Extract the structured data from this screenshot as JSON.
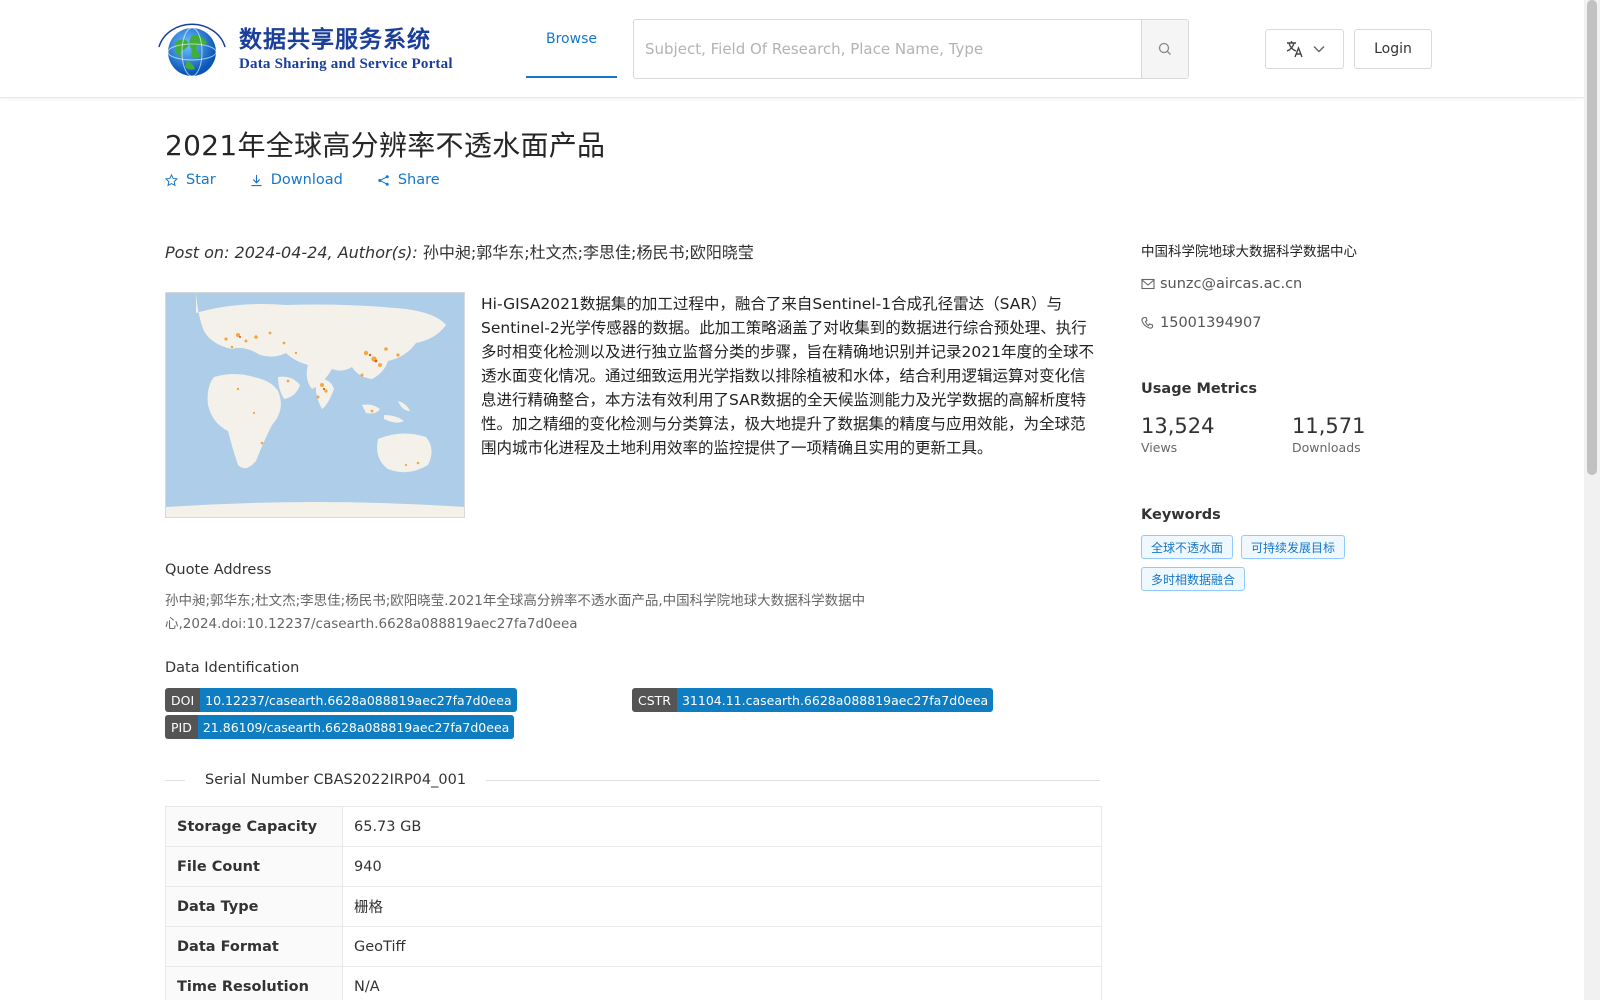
{
  "header": {
    "logo_cn": "数据共享服务系统",
    "logo_en": "Data Sharing and Service Portal",
    "nav_browse": "Browse",
    "search_placeholder": "Subject, Field Of Research, Place Name, Type",
    "login": "Login"
  },
  "dataset": {
    "title": "2021年全球高分辨率不透水面产品",
    "actions": {
      "star": "Star",
      "download": "Download",
      "share": "Share"
    },
    "post_label": "Post on: 2024-04-24, Author(s):",
    "authors": "孙中昶;郭华东;杜文杰;李思佳;杨民书;欧阳晓莹",
    "description": "Hi-GISA2021数据集的加工过程中，融合了来自Sentinel-1合成孔径雷达（SAR）与Sentinel-2光学传感器的数据。此加工策略涵盖了对收集到的数据进行综合预处理、执行多时相变化检测以及进行独立监督分类的步骤，旨在精确地识别并记录2021年度的全球不透水面变化情况。通过细致运用光学指数以排除植被和水体，结合利用逻辑运算对变化信息进行精确整合，本方法有效利用了SAR数据的全天候监测能力及光学数据的高解析度特性。加之精细的变化检测与分类算法，极大地提升了数据集的精度与应用效能，为全球范围内城市化进程及土地利用效率的监控提供了一项精确且实用的更新工具。",
    "quote_title": "Quote Address",
    "quote_text": "孙中昶;郭华东;杜文杰;李思佳;杨民书;欧阳晓莹.2021年全球高分辨率不透水面产品,中国科学院地球大数据科学数据中心,2024.doi:10.12237/casearth.6628a088819aec27fa7d0eea",
    "ident_title": "Data Identification",
    "doi_key": "DOI",
    "doi_value": "10.12237/casearth.6628a088819aec27fa7d0eea",
    "cstr_key": "CSTR",
    "cstr_value": "31104.11.casearth.6628a088819aec27fa7d0eea",
    "pid_key": "PID",
    "pid_value": "21.86109/casearth.6628a088819aec27fa7d0eea",
    "serial": "Serial Number CBAS2022IRP04_001",
    "table": [
      {
        "key": "Storage Capacity",
        "value": "65.73 GB"
      },
      {
        "key": "File Count",
        "value": "940"
      },
      {
        "key": "Data Type",
        "value": "栅格"
      },
      {
        "key": "Data Format",
        "value": "GeoTiff"
      },
      {
        "key": "Time Resolution",
        "value": "N/A"
      }
    ]
  },
  "sidebar": {
    "org": "中国科学院地球大数据科学数据中心",
    "email": "sunzc@aircas.ac.cn",
    "phone": "15001394907",
    "metrics_title": "Usage Metrics",
    "views_num": "13,524",
    "views_label": "Views",
    "downloads_num": "11,571",
    "downloads_label": "Downloads",
    "keywords_title": "Keywords",
    "keywords": [
      "全球不透水面",
      "可持续发展目标",
      "多时相数据融合"
    ]
  },
  "colors": {
    "accent": "#1677c8",
    "badge_value": "#0f7dc2",
    "badge_key": "#555555"
  }
}
